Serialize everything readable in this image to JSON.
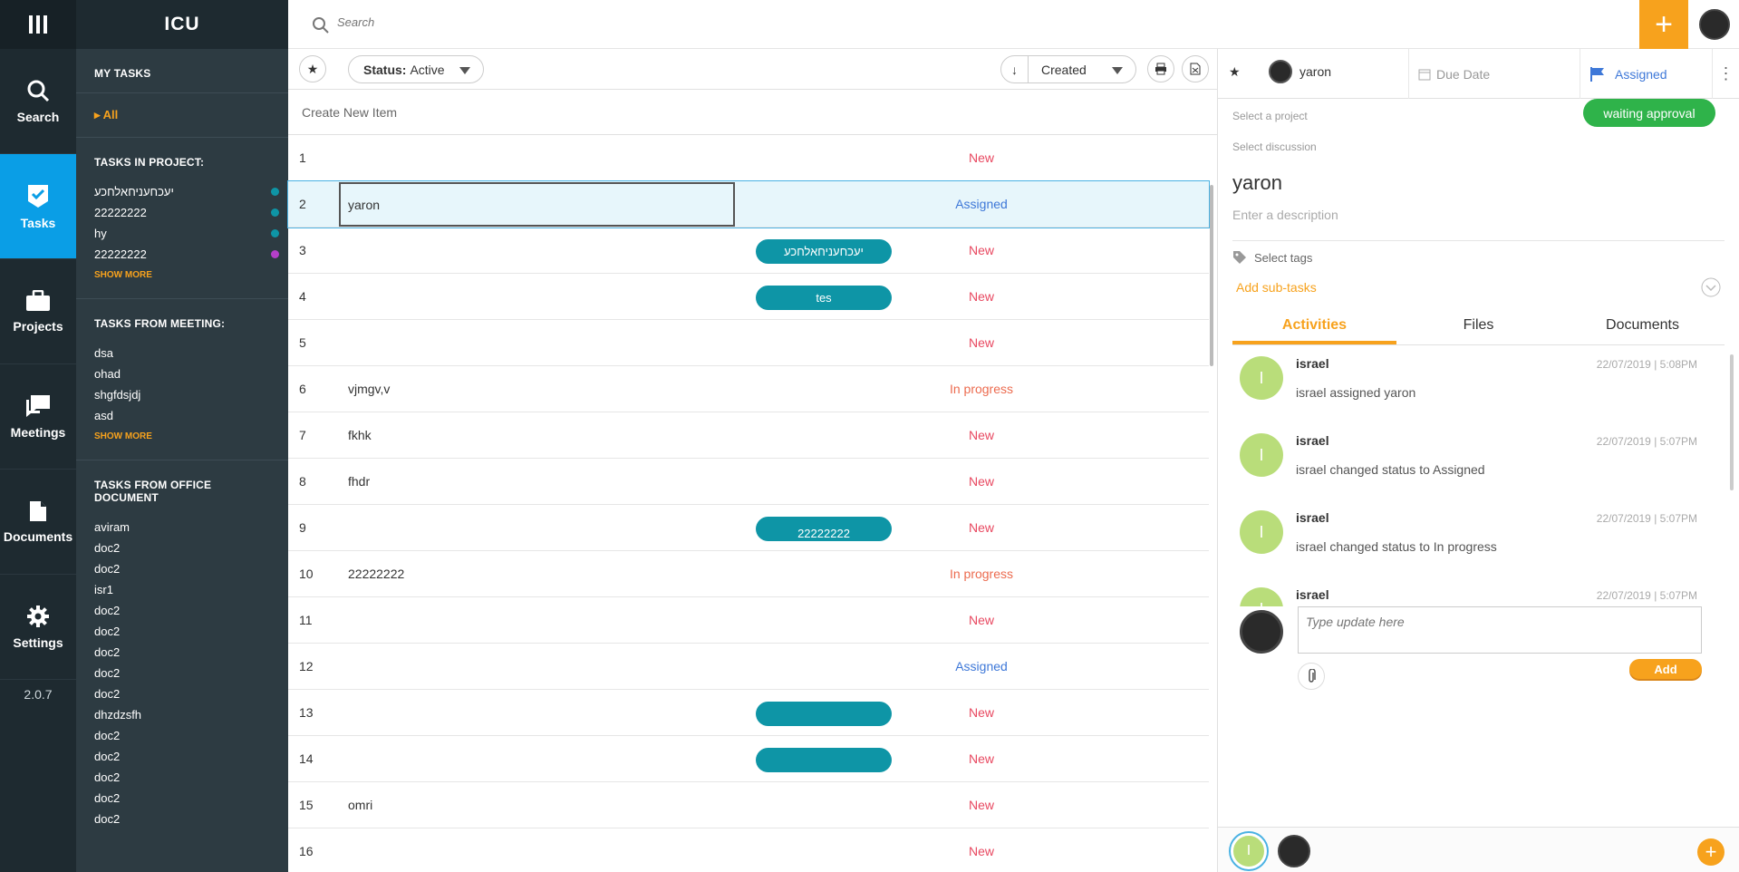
{
  "app": {
    "name": "ICU",
    "version": "2.0.7"
  },
  "rail": [
    {
      "label": "Search",
      "icon": "search-icon"
    },
    {
      "label": "Tasks",
      "icon": "tasks-icon",
      "active": true
    },
    {
      "label": "Projects",
      "icon": "briefcase-icon"
    },
    {
      "label": "Meetings",
      "icon": "chat-icon"
    },
    {
      "label": "Documents",
      "icon": "document-icon"
    },
    {
      "label": "Settings",
      "icon": "gear-icon"
    }
  ],
  "sidebar": {
    "my_tasks": "MY TASKS",
    "all": "All",
    "tasks_in_project": "TASKS IN PROJECT:",
    "projects": [
      {
        "label": "יעכחעניחאלחכע",
        "color": "#0e95a6"
      },
      {
        "label": "22222222",
        "color": "#0e95a6"
      },
      {
        "label": "hy",
        "color": "#0e95a6"
      },
      {
        "label": "22222222",
        "color": "#b53fc9"
      }
    ],
    "show_more": "SHOW MORE",
    "tasks_from_meeting": "TASKS FROM MEETING:",
    "meetings": [
      "dsa",
      "ohad",
      "shgfdsjdj",
      "asd"
    ],
    "tasks_from_office": "TASKS FROM OFFICE DOCUMENT",
    "documents": [
      "aviram",
      "doc2",
      "doc2",
      "isr1",
      "doc2",
      "doc2",
      "doc2",
      "doc2",
      "doc2",
      "dhzdzsfh",
      "doc2",
      "doc2",
      "doc2",
      "doc2",
      "doc2"
    ]
  },
  "search": {
    "placeholder": "Search"
  },
  "toolbar": {
    "status_label": "Status:",
    "status_value": "Active",
    "sort_label": "Created"
  },
  "list": {
    "create_new": "Create New Item",
    "rows": [
      {
        "num": "1",
        "title": "",
        "project": "",
        "status": "New"
      },
      {
        "num": "2",
        "title": "yaron",
        "project": "",
        "status": "Assigned"
      },
      {
        "num": "3",
        "title": "",
        "project": "יעכחעניחאלחכע",
        "status": "New"
      },
      {
        "num": "4",
        "title": "",
        "project": "tes",
        "status": "New"
      },
      {
        "num": "5",
        "title": "",
        "project": "",
        "status": "New"
      },
      {
        "num": "6",
        "title": "vjmgv,v",
        "project": "",
        "status": "In progress"
      },
      {
        "num": "7",
        "title": "fkhk",
        "project": "",
        "status": "New"
      },
      {
        "num": "8",
        "title": "fhdr",
        "project": "",
        "status": "New"
      },
      {
        "num": "9",
        "title": "",
        "project": "22222222",
        "status": "New"
      },
      {
        "num": "10",
        "title": "22222222",
        "project": "",
        "status": "In progress"
      },
      {
        "num": "11",
        "title": "",
        "project": "",
        "status": "New"
      },
      {
        "num": "12",
        "title": "",
        "project": "",
        "status": "Assigned"
      },
      {
        "num": "13",
        "title": "",
        "project": " ",
        "status": "New"
      },
      {
        "num": "14",
        "title": "",
        "project": " ",
        "status": "New"
      },
      {
        "num": "15",
        "title": "omri",
        "project": "",
        "status": "New"
      },
      {
        "num": "16",
        "title": "",
        "project": "",
        "status": "New"
      }
    ]
  },
  "detail": {
    "assignee": "yaron",
    "due_date": "Due Date",
    "status": "Assigned",
    "select_project": "Select a project",
    "select_discussion": "Select discussion",
    "approval": "waiting approval",
    "title": "yaron",
    "description_placeholder": "Enter a description",
    "select_tags": "Select tags",
    "add_subtasks": "Add sub-tasks",
    "tabs": [
      "Activities",
      "Files",
      "Documents"
    ],
    "activities": [
      {
        "initial": "I",
        "user": "israel",
        "time": "22/07/2019 | 5:08PM",
        "text": "israel assigned yaron"
      },
      {
        "initial": "I",
        "user": "israel",
        "time": "22/07/2019 | 5:07PM",
        "text": "israel changed status to Assigned"
      },
      {
        "initial": "I",
        "user": "israel",
        "time": "22/07/2019 | 5:07PM",
        "text": "israel changed status to In progress"
      },
      {
        "initial": "I",
        "user": "israel",
        "time": "22/07/2019 | 5:07PM",
        "text": ""
      }
    ],
    "update_placeholder": "Type update here",
    "add_button": "Add",
    "footer_initial": "I"
  }
}
